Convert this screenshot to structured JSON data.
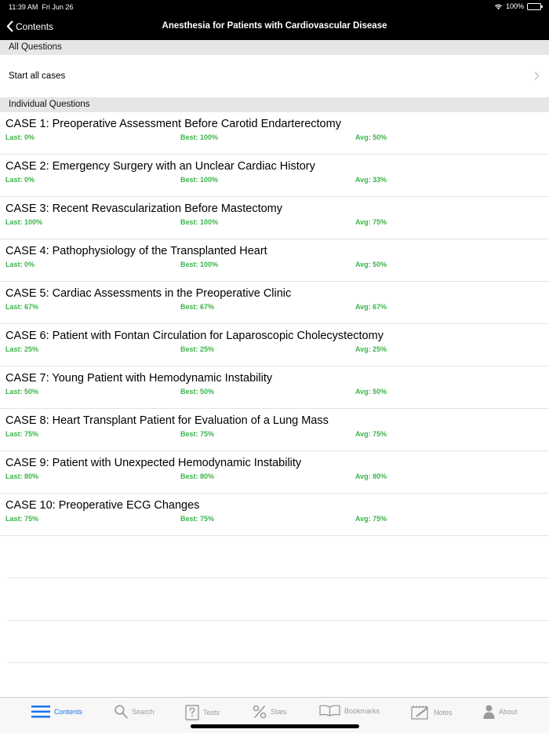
{
  "status_bar": {
    "time": "11:39 AM",
    "date": "Fri Jun 26",
    "battery": "100%"
  },
  "nav": {
    "back_label": "Contents",
    "title": "Anesthesia for Patients with Cardiovascular Disease"
  },
  "sections": {
    "all_questions": "All Questions",
    "individual_questions": "Individual Questions"
  },
  "start_all": {
    "label": "Start all cases"
  },
  "cases": [
    {
      "title": "CASE 1: Preoperative Assessment Before Carotid Endarterectomy",
      "last": "Last: 0%",
      "best": "Best: 100%",
      "avg": "Avg: 50%"
    },
    {
      "title": "CASE 2: Emergency Surgery with an Unclear Cardiac History",
      "last": "Last: 0%",
      "best": "Best: 100%",
      "avg": "Avg: 33%"
    },
    {
      "title": "CASE 3: Recent Revascularization Before Mastectomy",
      "last": "Last: 100%",
      "best": "Best: 100%",
      "avg": "Avg: 75%"
    },
    {
      "title": "CASE 4: Pathophysiology of the Transplanted Heart",
      "last": "Last: 0%",
      "best": "Best: 100%",
      "avg": "Avg: 50%"
    },
    {
      "title": "CASE 5: Cardiac Assessments in the Preoperative Clinic",
      "last": "Last: 67%",
      "best": "Best: 67%",
      "avg": "Avg: 67%"
    },
    {
      "title": "CASE 6: Patient with Fontan Circulation for Laparoscopic Cholecystectomy",
      "last": "Last: 25%",
      "best": "Best: 25%",
      "avg": "Avg: 25%"
    },
    {
      "title": "CASE 7: Young Patient with Hemodynamic Instability",
      "last": "Last: 50%",
      "best": "Best: 50%",
      "avg": "Avg: 50%"
    },
    {
      "title": "CASE 8: Heart Transplant Patient for Evaluation of a Lung Mass",
      "last": "Last: 75%",
      "best": "Best: 75%",
      "avg": "Avg: 75%"
    },
    {
      "title": "CASE 9: Patient with Unexpected Hemodynamic Instability",
      "last": "Last: 80%",
      "best": "Best: 80%",
      "avg": "Avg: 80%"
    },
    {
      "title": "CASE 10: Preoperative ECG Changes",
      "last": "Last: 75%",
      "best": "Best: 75%",
      "avg": "Avg: 75%"
    }
  ],
  "tabs": [
    {
      "label": "Contents",
      "icon": "list-icon",
      "active": true
    },
    {
      "label": "Search",
      "icon": "search-icon",
      "active": false
    },
    {
      "label": "Tests",
      "icon": "question-icon",
      "active": false
    },
    {
      "label": "Stats",
      "icon": "percent-icon",
      "active": false
    },
    {
      "label": "Bookmarks",
      "icon": "book-icon",
      "active": false
    },
    {
      "label": "Notes",
      "icon": "notes-icon",
      "active": false
    },
    {
      "label": "About",
      "icon": "person-icon",
      "active": false
    }
  ],
  "colors": {
    "accent": "#1a73e8",
    "stat_green": "#3cb44b",
    "section_bg": "#e6e6e6",
    "nav_bg": "#000000"
  }
}
